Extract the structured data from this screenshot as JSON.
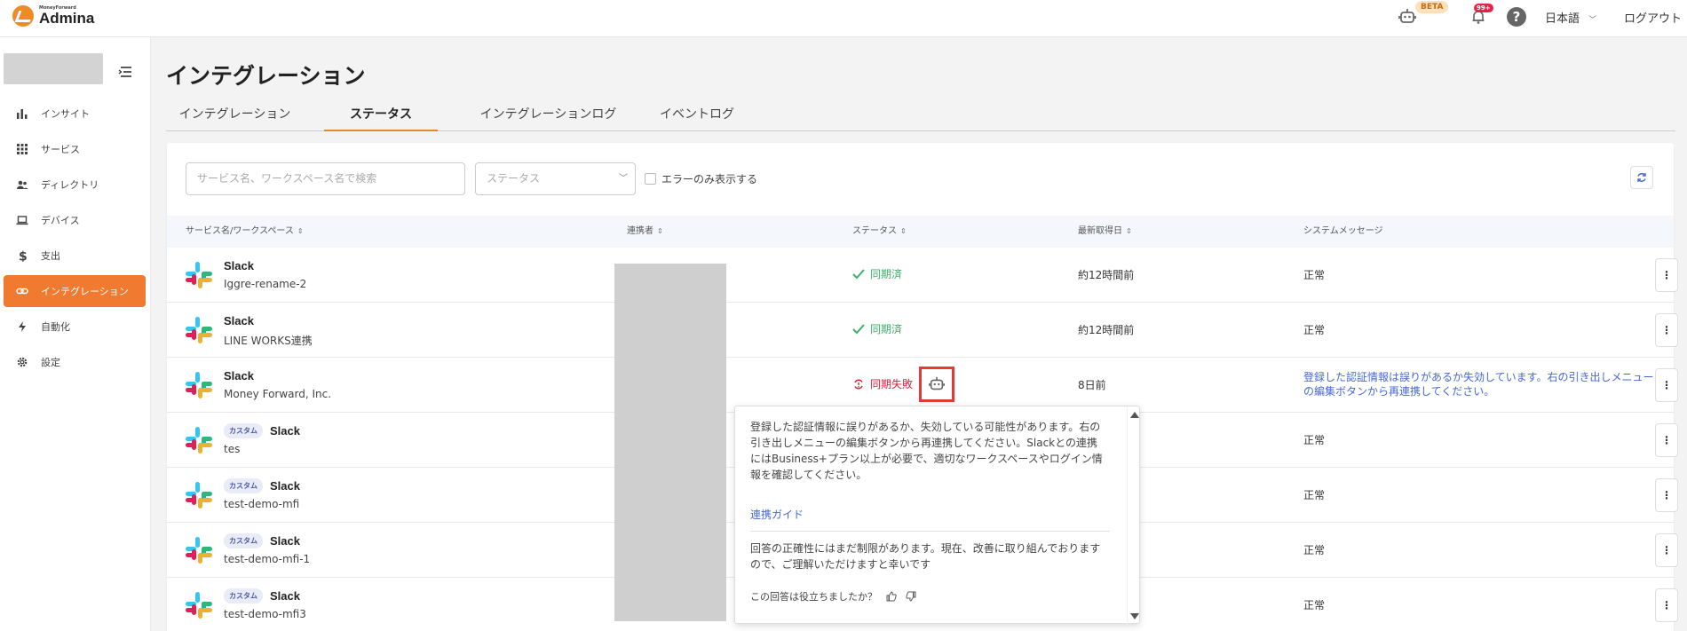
{
  "brand": {
    "small": "MoneyForward",
    "name": "Admina"
  },
  "header": {
    "beta": "BETA",
    "notifications": "99+",
    "help": "?",
    "language": "日本語",
    "logout": "ログアウト"
  },
  "sidebar": {
    "items": [
      {
        "label": "インサイト",
        "icon": "bar-chart-icon"
      },
      {
        "label": "サービス",
        "icon": "grid-icon"
      },
      {
        "label": "ディレクトリ",
        "icon": "users-icon"
      },
      {
        "label": "デバイス",
        "icon": "laptop-icon"
      },
      {
        "label": "支出",
        "icon": "dollar-icon"
      },
      {
        "label": "インテグレーション",
        "icon": "link-icon"
      },
      {
        "label": "自動化",
        "icon": "bolt-icon"
      },
      {
        "label": "設定",
        "icon": "gear-icon"
      }
    ]
  },
  "page": {
    "title": "インテグレーション"
  },
  "tabs": [
    "インテグレーション",
    "ステータス",
    "インテグレーションログ",
    "イベントログ"
  ],
  "filters": {
    "search_placeholder": "サービス名、ワークスペース名で検索",
    "status_placeholder": "ステータス",
    "error_only": "エラーのみ表示する"
  },
  "table": {
    "headers": [
      "サービス名/ワークスペース",
      "連携者",
      "ステータス",
      "最新取得日",
      "システムメッセージ"
    ],
    "rows": [
      {
        "service": "Slack",
        "workspace": "Iggre-rename-2",
        "tag": "",
        "status": "同期済",
        "updated": "約12時間前",
        "message": "正常"
      },
      {
        "service": "Slack",
        "workspace": "LINE WORKS連携",
        "tag": "",
        "status": "同期済",
        "updated": "約12時間前",
        "message": "正常"
      },
      {
        "service": "Slack",
        "workspace": "Money Forward, Inc.",
        "tag": "",
        "status": "同期失敗",
        "updated": "8日前",
        "message": "登録した認証情報は誤りがあるか失効しています。右の引き出しメニューの編集ボタンから再連携してください。"
      },
      {
        "service": "Slack",
        "workspace": "tes",
        "tag": "カスタム",
        "status": "",
        "updated": "",
        "message": "正常"
      },
      {
        "service": "Slack",
        "workspace": "test-demo-mfi",
        "tag": "カスタム",
        "status": "",
        "updated": "",
        "message": "正常"
      },
      {
        "service": "Slack",
        "workspace": "test-demo-mfi-1",
        "tag": "カスタム",
        "status": "",
        "updated": "",
        "message": "正常"
      },
      {
        "service": "Slack",
        "workspace": "test-demo-mfi3",
        "tag": "カスタム",
        "status": "",
        "updated": "",
        "message": "正常"
      }
    ]
  },
  "popover": {
    "text": "登録した認証情報に誤りがあるか、失効している可能性があります。右の引き出しメニューの編集ボタンから再連携してください。Slackとの連携にはBusiness+プラン以上が必要で、適切なワークスペースやログイン情報を確認してください。",
    "link": "連携ガイド",
    "note": "回答の正確性にはまだ制限があります。現在、改善に取り組んでおりますので、ご理解いただけますと幸いです",
    "feedback": "この回答は役立ちましたか？"
  },
  "colors": {
    "accent": "#f07a2f",
    "ok": "#3bb069",
    "fail": "#d8213f",
    "link": "#4768d6",
    "highlight": "#e53935"
  }
}
